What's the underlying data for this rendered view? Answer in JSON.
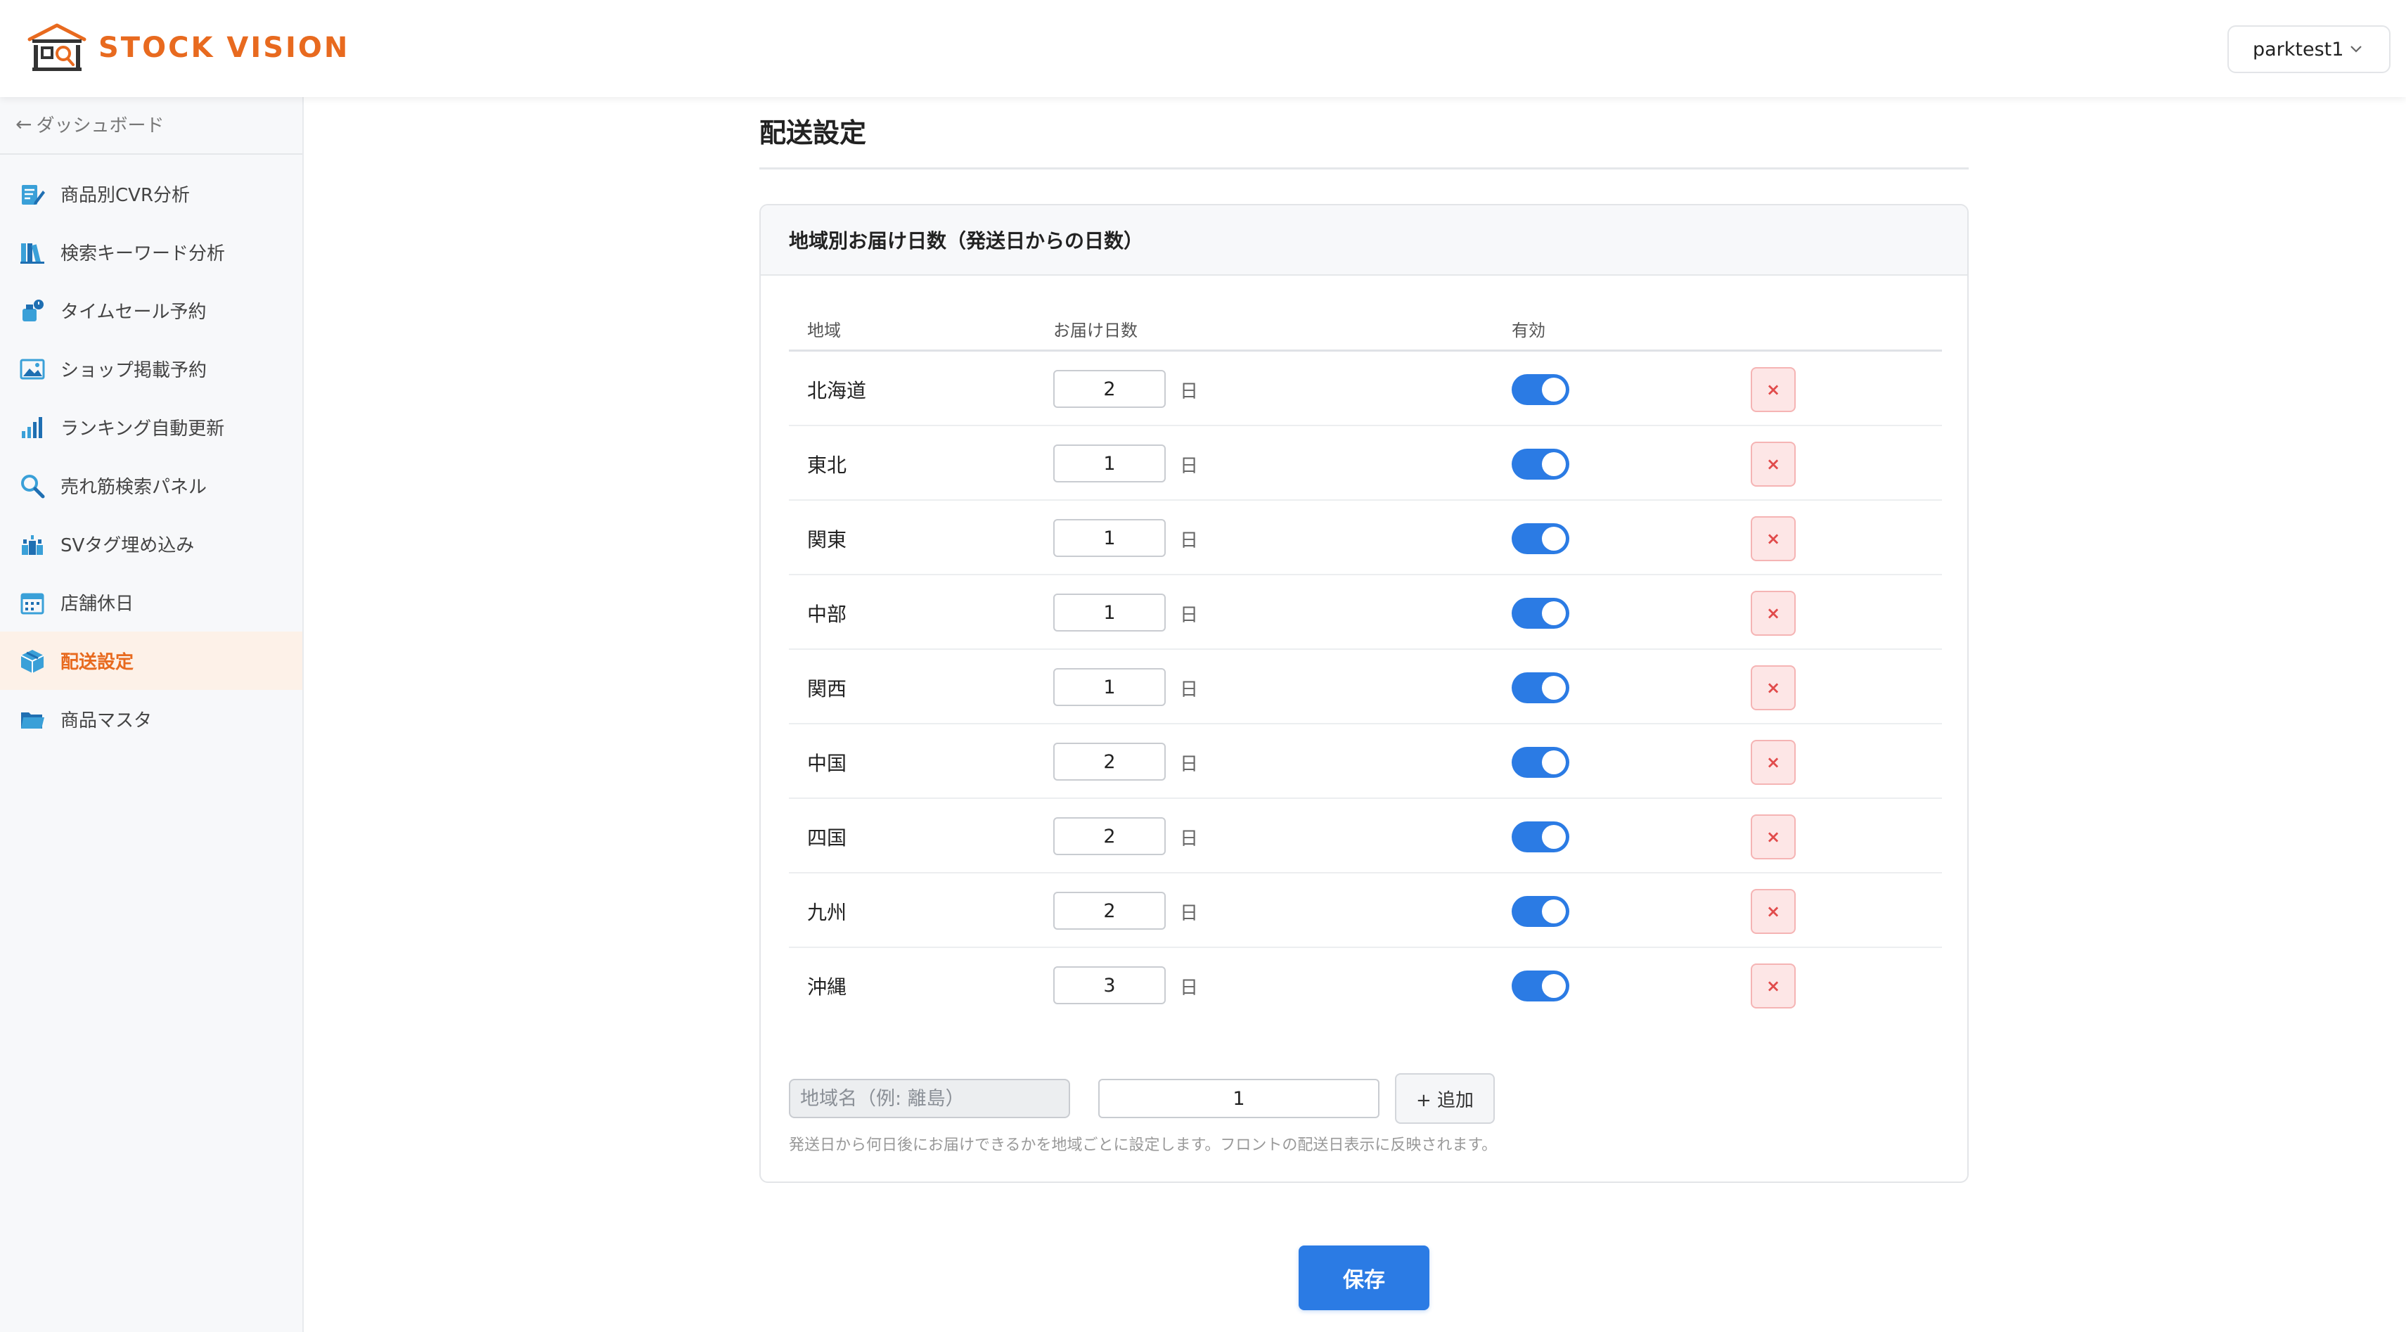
{
  "app": {
    "brand": "STOCK VISION",
    "brand_color": "#e86a1f",
    "accent_color": "#2b7be4",
    "user": "parktest1"
  },
  "sidebar": {
    "back_label": "ダッシュボード",
    "items": [
      {
        "label": "商品別CVR分析",
        "icon": "edit-document-icon",
        "active": false
      },
      {
        "label": "検索キーワード分析",
        "icon": "books-icon",
        "active": false
      },
      {
        "label": "タイムセール予約",
        "icon": "timer-bottle-icon",
        "active": false
      },
      {
        "label": "ショップ掲載予約",
        "icon": "image-icon",
        "active": false
      },
      {
        "label": "ランキング自動更新",
        "icon": "bar-chart-icon",
        "active": false
      },
      {
        "label": "売れ筋検索パネル",
        "icon": "search-icon",
        "active": false
      },
      {
        "label": "SVタグ埋め込み",
        "icon": "tag-blocks-icon",
        "active": false
      },
      {
        "label": "店舗休日",
        "icon": "calendar-icon",
        "active": false
      },
      {
        "label": "配送設定",
        "icon": "package-icon",
        "active": true
      },
      {
        "label": "商品マスタ",
        "icon": "folder-icon",
        "active": false
      }
    ]
  },
  "main": {
    "page_title": "配送設定",
    "card_title": "地域別お届け日数（発送日からの日数）",
    "columns": {
      "region": "地域",
      "days": "お届け日数",
      "enabled": "有効"
    },
    "day_unit": "日",
    "delete_label": "×",
    "rows": [
      {
        "region": "北海道",
        "days": "2",
        "enabled": true
      },
      {
        "region": "東北",
        "days": "1",
        "enabled": true
      },
      {
        "region": "関東",
        "days": "1",
        "enabled": true
      },
      {
        "region": "中部",
        "days": "1",
        "enabled": true
      },
      {
        "region": "関西",
        "days": "1",
        "enabled": true
      },
      {
        "region": "中国",
        "days": "2",
        "enabled": true
      },
      {
        "region": "四国",
        "days": "2",
        "enabled": true
      },
      {
        "region": "九州",
        "days": "2",
        "enabled": true
      },
      {
        "region": "沖縄",
        "days": "3",
        "enabled": true
      }
    ],
    "add_form": {
      "region_placeholder": "地域名（例: 離島）",
      "days_value": "1",
      "add_label": "+ 追加"
    },
    "help_text": "発送日から何日後にお届けできるかを地域ごとに設定します。フロントの配送日表示に反映されます。",
    "save_label": "保存"
  }
}
